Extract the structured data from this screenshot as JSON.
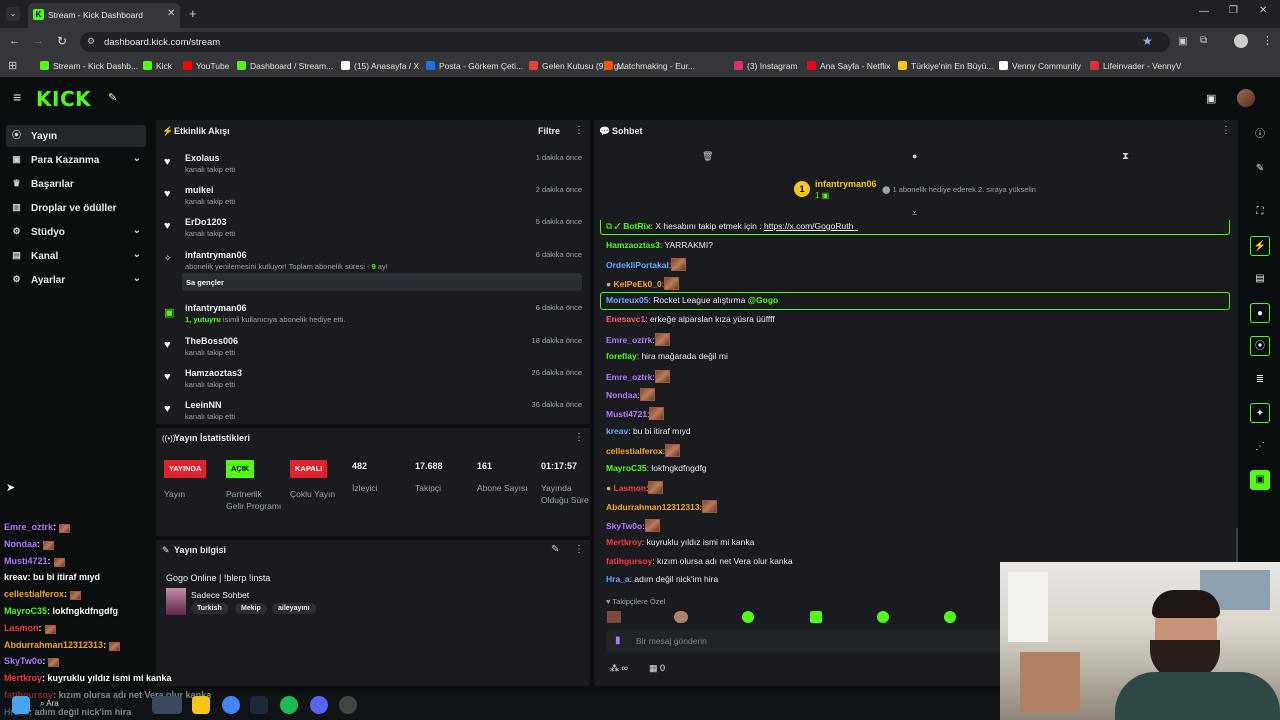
{
  "browser": {
    "tab_title": "Stream - Kick Dashboard",
    "url": "dashboard.kick.com/stream",
    "bookmarks": [
      {
        "label": "Stream - Kick Dashb...",
        "color": "#53fc18"
      },
      {
        "label": "Kick",
        "color": "#53fc18"
      },
      {
        "label": "YouTube",
        "color": "#ff0000"
      },
      {
        "label": "Dashboard / Stream...",
        "color": "#53fc18"
      },
      {
        "label": "(15) Anasayfa / X",
        "color": "#ffffff"
      },
      {
        "label": "Posta - Görkem Çeti...",
        "color": "#1a73e8"
      },
      {
        "label": "Gelen Kutusu (9) - g...",
        "color": "#ea4335"
      },
      {
        "label": "Matchmaking - Eur...",
        "color": "#ff5500"
      },
      {
        "label": "(3) Instagram",
        "color": "#e1306c"
      },
      {
        "label": "Ana Sayfa - Netflix",
        "color": "#e50914"
      },
      {
        "label": "Türkiye'nin En Büyü...",
        "color": "#f5c518"
      },
      {
        "label": "Venny Community",
        "color": "#ffffff"
      },
      {
        "label": "Lifeinvader - VennyV",
        "color": "#e03030"
      }
    ]
  },
  "app": {
    "logo": "KICK",
    "accent": "#53fc18"
  },
  "sidebar": {
    "items": [
      {
        "label": "Yayın",
        "icon": "broadcast-icon",
        "active": true
      },
      {
        "label": "Para Kazanma",
        "icon": "money-icon",
        "expandable": true
      },
      {
        "label": "Başarılar",
        "icon": "trophy-icon"
      },
      {
        "label": "Droplar ve ödüller",
        "icon": "gift-icon"
      },
      {
        "label": "Stüdyo",
        "icon": "studio-icon",
        "expandable": true
      },
      {
        "label": "Kanal",
        "icon": "channel-icon",
        "expandable": true
      },
      {
        "label": "Ayarlar",
        "icon": "settings-icon",
        "expandable": true
      }
    ]
  },
  "activity": {
    "title": "Etkinlik Akışı",
    "filter": "Filtre",
    "items": [
      {
        "name": "Exolaus",
        "sub": "kanalı takip etti",
        "time": "1 dakika önce"
      },
      {
        "name": "muikei",
        "sub": "kanalı takip etti",
        "time": "2 dakika önce"
      },
      {
        "name": "ErDo1203",
        "sub": "kanalı takip etti",
        "time": "5 dakika önce"
      },
      {
        "name": "infantryman06",
        "sub": "abonelik yenilemesini kutluyor! Toplam abonelik süresi - ",
        "months": "9",
        "sub2": " ay!",
        "time": "6 dakika önce",
        "reply": "Sa gençler"
      },
      {
        "name": "infantryman06",
        "sub_hl": "1, yutuyru",
        "sub": " isimli kullanıcıya abonelik hediye etti.",
        "time": "6 dakika önce"
      },
      {
        "name": "TheBoss006",
        "sub": "kanalı takip etti",
        "time": "18 dakika önce"
      },
      {
        "name": "Hamzaoztas3",
        "sub": "kanalı takip etti",
        "time": "26 dakika önce"
      },
      {
        "name": "LeeinNN",
        "sub": "kanalı takip etti",
        "time": "36 dakika önce"
      }
    ]
  },
  "stats": {
    "title": "Yayın İstatistikleri",
    "cols": [
      {
        "badge": "YAYINDA",
        "badge_color": "#e0222f",
        "label": "Yayın"
      },
      {
        "badge": "AÇIK",
        "badge_color": "#53fc18",
        "label": "Partnerlik Gelir Programı"
      },
      {
        "badge": "KAPALI",
        "badge_color": "#e0222f",
        "label": "Çoklu Yayın"
      },
      {
        "value": "482",
        "label": "İzleyici"
      },
      {
        "value": "17.688",
        "label": "Takipçi"
      },
      {
        "value": "161",
        "label": "Abone Sayısı"
      },
      {
        "value": "01:17:57",
        "label": "Yayında Olduğu Süre"
      }
    ]
  },
  "info": {
    "title": "Yayın bilgisi",
    "stream_title": "Gogo Online | !blerp !insta",
    "category": "Sadece Sohbet",
    "tags": [
      "Turkish",
      "Mekip",
      "aileyayını"
    ]
  },
  "chat": {
    "title": "Sohbet",
    "pinned_user": "infantryman06",
    "pinned_count": "1",
    "pinned_msg": "1 abonelik hediye ederek 2. sıraya yükselin",
    "lines": [
      {
        "user": "BotRix",
        "color": "#53fc18",
        "text": ": X hesabını takip etmek için : ",
        "link": "https://x.com/GogoRuth_",
        "boxed": true
      },
      {
        "user": "Hamzaoztas3",
        "color": "#53fc18",
        "text": ": YARRAKMI?"
      },
      {
        "user": "OrdekliPortakal",
        "color": "#6aa8ff",
        "text": ":",
        "emote": true
      },
      {
        "user": "KelPeEk0_0",
        "color": "#f5a623",
        "text": ":",
        "emote": true
      },
      {
        "user": "Morteux05",
        "color": "#6aa8ff",
        "text": ": Rocket League alıştırma ",
        "mention": "@Gogo",
        "boxed": true
      },
      {
        "user": "Enesavc1",
        "color": "#ff5a6e",
        "text": ": erkeğe alparslan kıza yüsra üüffff"
      },
      {
        "user": "Emre_oztrk",
        "color": "#b57aff",
        "text": ":",
        "emote": true
      },
      {
        "user": "foreflay",
        "color": "#53fc18",
        "text": ": hira mağarada değil mi"
      },
      {
        "user": "Emre_oztrk",
        "color": "#b57aff",
        "text": ":",
        "emote": true
      },
      {
        "user": "Nondaa",
        "color": "#b57aff",
        "text": ":",
        "emote": true
      },
      {
        "user": "Musti4721",
        "color": "#b57aff",
        "text": ":",
        "emote": true
      },
      {
        "user": "kreav",
        "color": "#6aa8ff",
        "text": ": bu bi itiraf mıyd"
      },
      {
        "user": "cellestialferox",
        "color": "#f5a623",
        "text": ":",
        "emote": true
      },
      {
        "user": "MayroC35",
        "color": "#53fc18",
        "text": ": lokfngkdfngdfg"
      },
      {
        "user": "Lasmon",
        "color": "#ff3b3b",
        "text": ":",
        "emote": true
      },
      {
        "user": "Abdurrahman12312313",
        "color": "#f5a623",
        "text": ":",
        "emote": true
      },
      {
        "user": "SkyTw0o",
        "color": "#b57aff",
        "text": ":",
        "emote": true
      },
      {
        "user": "Mertkroy",
        "color": "#ff3b3b",
        "text": ": kuyruklu yıldız ismi mi kanka"
      },
      {
        "user": "fatihgursoy",
        "color": "#ff3b3b",
        "text": ": kızım olursa adı net Vera olur kanka"
      },
      {
        "user": "Hra_a",
        "color": "#6aa8ff",
        "text": ": adım değil nick'im hira"
      }
    ],
    "mode": "Takipçilere Özel",
    "placeholder": "Bir mesaj gönderin",
    "infinity": "∞",
    "count": "0"
  },
  "overlay_chat": [
    {
      "user": "Emre_oztrk",
      "color": "#b57aff",
      "text": ":"
    },
    {
      "user": "Nondaa",
      "color": "#b57aff",
      "text": ":"
    },
    {
      "user": "Musti4721",
      "color": "#b57aff",
      "text": ":"
    },
    {
      "user": "kreav",
      "color": "#ffffff",
      "text": ": bu bi itiraf mıyd"
    },
    {
      "user": "cellestialferox",
      "color": "#f5a623",
      "text": ":"
    },
    {
      "user": "MayroC35",
      "color": "#53fc18",
      "text": ": lokfngkdfngdfg"
    },
    {
      "user": "Lasmon",
      "color": "#ff3b3b",
      "text": ":"
    },
    {
      "user": "Abdurrahman12312313",
      "color": "#f5a623",
      "text": ":"
    },
    {
      "user": "SkyTw0o",
      "color": "#b57aff",
      "text": ":"
    },
    {
      "user": "Mertkroy",
      "color": "#ff3b3b",
      "text": ": kuyruklu yıldız ismi mi kanka"
    },
    {
      "user": "fatihgursoy",
      "color": "#ff3b3b",
      "text": ": kızım olursa adı net Vera olur kanka"
    },
    {
      "user": "Hra_a",
      "color": "#6aa8ff",
      "text": ": adım değil nick'im hira"
    }
  ],
  "taskbar": {
    "search": "Ara"
  }
}
